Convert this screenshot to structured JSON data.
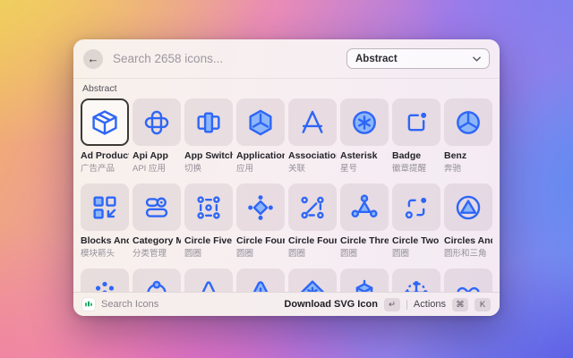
{
  "header": {
    "search_placeholder": "Search 2658 icons...",
    "category_value": "Abstract"
  },
  "section": {
    "label": "Abstract"
  },
  "grid": {
    "items": [
      {
        "name": "Ad Product",
        "zh": "广告产品",
        "icon": "ad-product",
        "selected": true
      },
      {
        "name": "Api App",
        "zh": "API 应用",
        "icon": "api-app"
      },
      {
        "name": "App Switch",
        "zh": "切换",
        "icon": "app-switch"
      },
      {
        "name": "Application...",
        "zh": "应用",
        "icon": "application"
      },
      {
        "name": "Association",
        "zh": "关联",
        "icon": "association"
      },
      {
        "name": "Asterisk",
        "zh": "星号",
        "icon": "asterisk"
      },
      {
        "name": "Badge",
        "zh": "徽章提醒",
        "icon": "badge"
      },
      {
        "name": "Benz",
        "zh": "奔驰",
        "icon": "benz"
      },
      {
        "name": "Blocks And...",
        "zh": "模块箭头",
        "icon": "blocks-and-arrows"
      },
      {
        "name": "Category M...",
        "zh": "分类管理",
        "icon": "category-management"
      },
      {
        "name": "Circle Five L...",
        "zh": "圆圈",
        "icon": "circle-five-line"
      },
      {
        "name": "Circle Four",
        "zh": "圆圈",
        "icon": "circle-four"
      },
      {
        "name": "Circle Four...",
        "zh": "圆圈",
        "icon": "circle-four-line"
      },
      {
        "name": "Circle Three",
        "zh": "圆圈",
        "icon": "circle-three"
      },
      {
        "name": "Circle Two L...",
        "zh": "圆圈",
        "icon": "circle-two-line"
      },
      {
        "name": "Circles And...",
        "zh": "圆形和三角",
        "icon": "circles-and-triangles"
      },
      {
        "name": "",
        "zh": "",
        "icon": "dots-seven"
      },
      {
        "name": "",
        "zh": "",
        "icon": "connection-circle"
      },
      {
        "name": "",
        "zh": "",
        "icon": "cone"
      },
      {
        "name": "",
        "zh": "",
        "icon": "triangle-round"
      },
      {
        "name": "",
        "zh": "",
        "icon": "diamond-asterisk"
      },
      {
        "name": "",
        "zh": "",
        "icon": "cube-three-d"
      },
      {
        "name": "",
        "zh": "",
        "icon": "direction-cross"
      },
      {
        "name": "",
        "zh": "",
        "icon": "infinity"
      }
    ]
  },
  "footer": {
    "app_label": "Search Icons",
    "primary_action": "Download SVG Icon",
    "primary_key": "↵",
    "secondary_action": "Actions",
    "keys": [
      "⌘",
      "K"
    ]
  },
  "colors": {
    "icon_stroke": "#2e66f6",
    "icon_fill": "#8cb6f9",
    "logo_green": "#2bb673",
    "selected_border": "#3d3a35"
  }
}
